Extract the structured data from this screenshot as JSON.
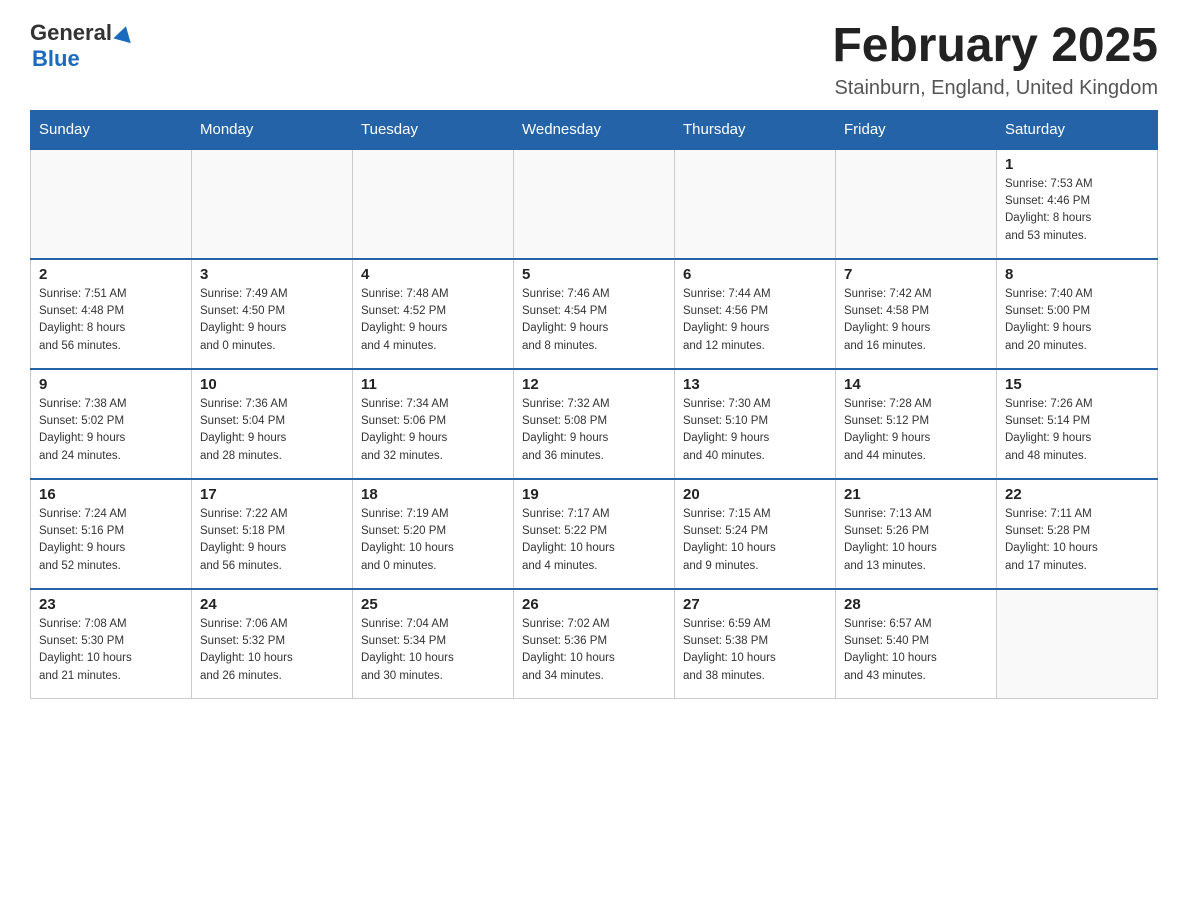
{
  "header": {
    "logo_general": "General",
    "logo_blue": "Blue",
    "month_title": "February 2025",
    "location": "Stainburn, England, United Kingdom"
  },
  "days_of_week": [
    "Sunday",
    "Monday",
    "Tuesday",
    "Wednesday",
    "Thursday",
    "Friday",
    "Saturday"
  ],
  "weeks": [
    [
      {
        "day": "",
        "info": ""
      },
      {
        "day": "",
        "info": ""
      },
      {
        "day": "",
        "info": ""
      },
      {
        "day": "",
        "info": ""
      },
      {
        "day": "",
        "info": ""
      },
      {
        "day": "",
        "info": ""
      },
      {
        "day": "1",
        "info": "Sunrise: 7:53 AM\nSunset: 4:46 PM\nDaylight: 8 hours\nand 53 minutes."
      }
    ],
    [
      {
        "day": "2",
        "info": "Sunrise: 7:51 AM\nSunset: 4:48 PM\nDaylight: 8 hours\nand 56 minutes."
      },
      {
        "day": "3",
        "info": "Sunrise: 7:49 AM\nSunset: 4:50 PM\nDaylight: 9 hours\nand 0 minutes."
      },
      {
        "day": "4",
        "info": "Sunrise: 7:48 AM\nSunset: 4:52 PM\nDaylight: 9 hours\nand 4 minutes."
      },
      {
        "day": "5",
        "info": "Sunrise: 7:46 AM\nSunset: 4:54 PM\nDaylight: 9 hours\nand 8 minutes."
      },
      {
        "day": "6",
        "info": "Sunrise: 7:44 AM\nSunset: 4:56 PM\nDaylight: 9 hours\nand 12 minutes."
      },
      {
        "day": "7",
        "info": "Sunrise: 7:42 AM\nSunset: 4:58 PM\nDaylight: 9 hours\nand 16 minutes."
      },
      {
        "day": "8",
        "info": "Sunrise: 7:40 AM\nSunset: 5:00 PM\nDaylight: 9 hours\nand 20 minutes."
      }
    ],
    [
      {
        "day": "9",
        "info": "Sunrise: 7:38 AM\nSunset: 5:02 PM\nDaylight: 9 hours\nand 24 minutes."
      },
      {
        "day": "10",
        "info": "Sunrise: 7:36 AM\nSunset: 5:04 PM\nDaylight: 9 hours\nand 28 minutes."
      },
      {
        "day": "11",
        "info": "Sunrise: 7:34 AM\nSunset: 5:06 PM\nDaylight: 9 hours\nand 32 minutes."
      },
      {
        "day": "12",
        "info": "Sunrise: 7:32 AM\nSunset: 5:08 PM\nDaylight: 9 hours\nand 36 minutes."
      },
      {
        "day": "13",
        "info": "Sunrise: 7:30 AM\nSunset: 5:10 PM\nDaylight: 9 hours\nand 40 minutes."
      },
      {
        "day": "14",
        "info": "Sunrise: 7:28 AM\nSunset: 5:12 PM\nDaylight: 9 hours\nand 44 minutes."
      },
      {
        "day": "15",
        "info": "Sunrise: 7:26 AM\nSunset: 5:14 PM\nDaylight: 9 hours\nand 48 minutes."
      }
    ],
    [
      {
        "day": "16",
        "info": "Sunrise: 7:24 AM\nSunset: 5:16 PM\nDaylight: 9 hours\nand 52 minutes."
      },
      {
        "day": "17",
        "info": "Sunrise: 7:22 AM\nSunset: 5:18 PM\nDaylight: 9 hours\nand 56 minutes."
      },
      {
        "day": "18",
        "info": "Sunrise: 7:19 AM\nSunset: 5:20 PM\nDaylight: 10 hours\nand 0 minutes."
      },
      {
        "day": "19",
        "info": "Sunrise: 7:17 AM\nSunset: 5:22 PM\nDaylight: 10 hours\nand 4 minutes."
      },
      {
        "day": "20",
        "info": "Sunrise: 7:15 AM\nSunset: 5:24 PM\nDaylight: 10 hours\nand 9 minutes."
      },
      {
        "day": "21",
        "info": "Sunrise: 7:13 AM\nSunset: 5:26 PM\nDaylight: 10 hours\nand 13 minutes."
      },
      {
        "day": "22",
        "info": "Sunrise: 7:11 AM\nSunset: 5:28 PM\nDaylight: 10 hours\nand 17 minutes."
      }
    ],
    [
      {
        "day": "23",
        "info": "Sunrise: 7:08 AM\nSunset: 5:30 PM\nDaylight: 10 hours\nand 21 minutes."
      },
      {
        "day": "24",
        "info": "Sunrise: 7:06 AM\nSunset: 5:32 PM\nDaylight: 10 hours\nand 26 minutes."
      },
      {
        "day": "25",
        "info": "Sunrise: 7:04 AM\nSunset: 5:34 PM\nDaylight: 10 hours\nand 30 minutes."
      },
      {
        "day": "26",
        "info": "Sunrise: 7:02 AM\nSunset: 5:36 PM\nDaylight: 10 hours\nand 34 minutes."
      },
      {
        "day": "27",
        "info": "Sunrise: 6:59 AM\nSunset: 5:38 PM\nDaylight: 10 hours\nand 38 minutes."
      },
      {
        "day": "28",
        "info": "Sunrise: 6:57 AM\nSunset: 5:40 PM\nDaylight: 10 hours\nand 43 minutes."
      },
      {
        "day": "",
        "info": ""
      }
    ]
  ]
}
